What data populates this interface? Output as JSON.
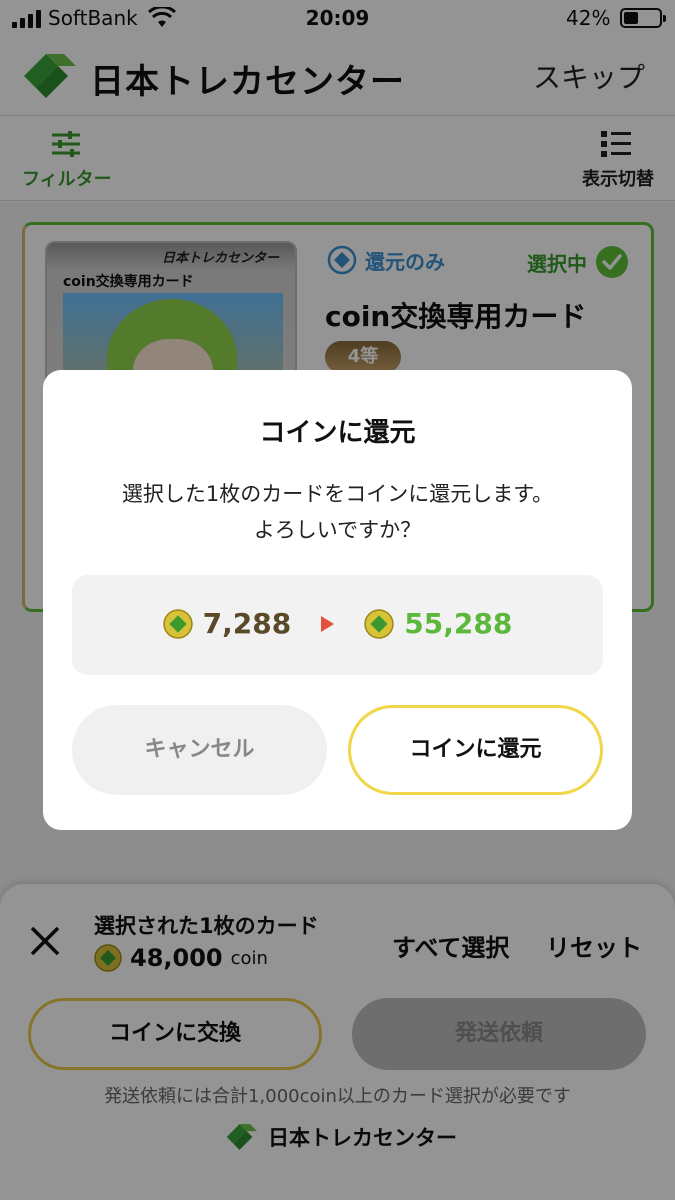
{
  "status_bar": {
    "carrier": "SoftBank",
    "time": "20:09",
    "battery_percent": "42%"
  },
  "header": {
    "brand": "日本トレカセンター",
    "skip": "スキップ"
  },
  "toolbar": {
    "filter_label": "フィルター",
    "view_label": "表示切替"
  },
  "card": {
    "image_brand": "日本トレカセンター",
    "image_title": "coin交換専用カード",
    "badge": "還元のみ",
    "selected_label": "選択中",
    "name": "coin交換専用カード",
    "rank": "4等"
  },
  "modal": {
    "title": "コインに還元",
    "message_line1": "選択した1枚のカードをコインに還元します。",
    "message_line2": "よろしいですか？",
    "coin_before": "7,288",
    "coin_after": "55,288",
    "cancel_label": "キャンセル",
    "confirm_label": "コインに還元"
  },
  "bottom_bar": {
    "selected_count": "選択された1枚のカード",
    "coin_value": "48,000",
    "coin_unit": "coin",
    "select_all": "すべて選択",
    "reset": "リセット",
    "exchange_label": "コインに交換",
    "ship_label": "発送依頼",
    "ship_note": "発送依頼には合計1,000coin以上のカード選択が必要です",
    "footer_brand": "日本トレカセンター"
  },
  "colors": {
    "brand_green": "#3a9a2e",
    "accent_yellow": "#f0d648",
    "arrow_red": "#e0503a",
    "coin_gain_green": "#5cb83a"
  }
}
